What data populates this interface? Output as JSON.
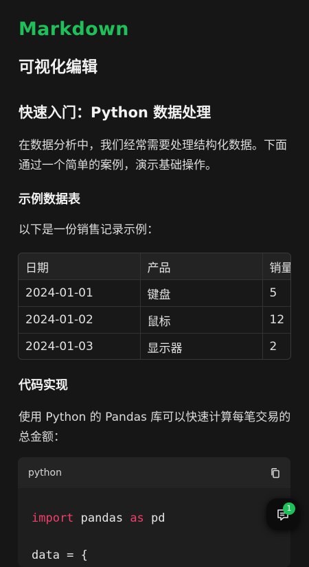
{
  "brand": "Markdown",
  "tagline": "可视化编辑",
  "article": {
    "title": "快速入门：Python 数据处理",
    "intro": "在数据分析中，我们经常需要处理结构化数据。下面通过一个简单的案例，演示基础操作。",
    "section1": {
      "heading": "示例数据表",
      "text": "以下是一份销售记录示例："
    },
    "table": {
      "headers": [
        "日期",
        "产品",
        "销量"
      ],
      "rows": [
        [
          "2024-01-01",
          "键盘",
          "5"
        ],
        [
          "2024-01-02",
          "鼠标",
          "12"
        ],
        [
          "2024-01-03",
          "显示器",
          "2"
        ]
      ]
    },
    "section2": {
      "heading": "代码实现",
      "text": "使用 Python 的 Pandas 库可以快速计算每笔交易的总金额："
    },
    "code": {
      "language": "python",
      "line1": {
        "kw1": "import",
        "mod": " pandas ",
        "kw2": "as",
        "alias": " pd"
      },
      "line2": "data = {"
    }
  },
  "fab": {
    "icon": "chat-icon",
    "badge": "1"
  },
  "colors": {
    "accent": "#1fbf5a",
    "keyword": "#f0406b",
    "background": "#161616"
  }
}
